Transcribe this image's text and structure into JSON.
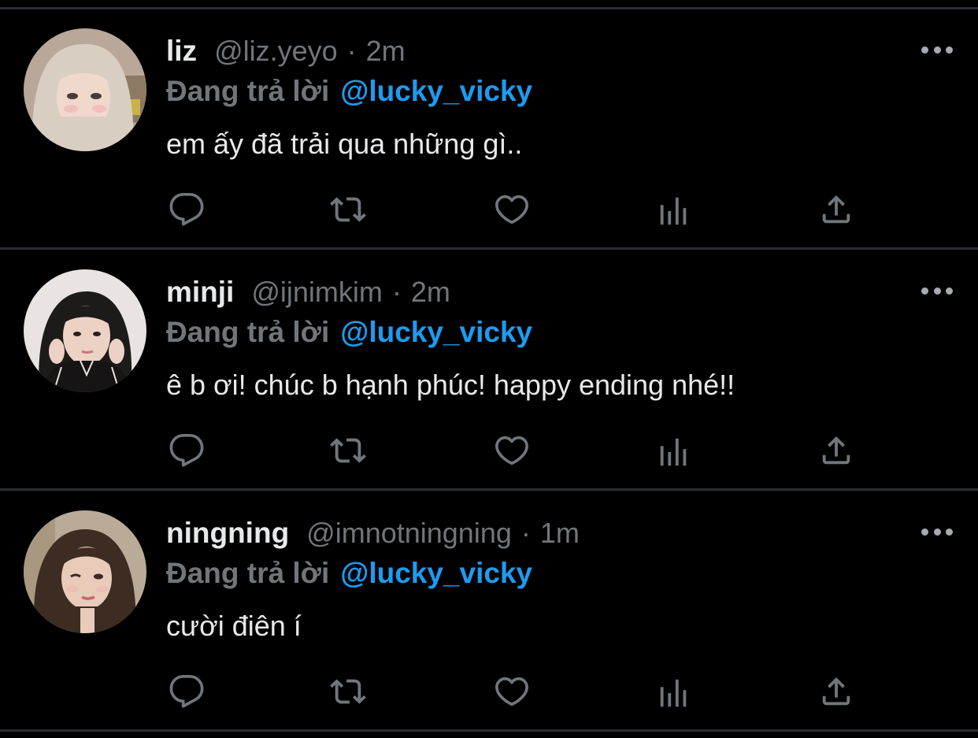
{
  "tweets": [
    {
      "name": "liz",
      "handle": "@liz.yeyo",
      "separator": "·",
      "time": "2m",
      "replying_prefix": "Đang trả lời",
      "replying_to": "@lucky_vicky",
      "text": "em ấy đã trải qua những gì..",
      "avatar_colors": {
        "bg": "#b9a89a",
        "hair": "#d8cfc2",
        "skin": "#f1d8cc"
      }
    },
    {
      "name": "minji",
      "handle": "@ijnimkim",
      "separator": "·",
      "time": "2m",
      "replying_prefix": "Đang trả lời",
      "replying_to": "@lucky_vicky",
      "text": "ê b ơi! chúc b hạnh phúc! happy ending nhé!!",
      "avatar_colors": {
        "bg": "#e9e4e2",
        "hair": "#1d1a1a",
        "skin": "#ecd2c4"
      }
    },
    {
      "name": "ningning",
      "handle": "@imnotningning",
      "separator": "·",
      "time": "1m",
      "replying_prefix": "Đang trả lời",
      "replying_to": "@lucky_vicky",
      "text": "cười điên í",
      "avatar_colors": {
        "bg": "#b9ab98",
        "hair": "#3d2c22",
        "skin": "#e9cbb9"
      }
    }
  ],
  "icons": [
    "reply-icon",
    "retweet-icon",
    "like-icon",
    "analytics-icon",
    "share-icon",
    "more-icon"
  ],
  "colors": {
    "background": "#000000",
    "primary_text": "#e7e9ea",
    "secondary_text": "#71767b",
    "link": "#1d9bf0",
    "icon": "#71767b",
    "divider": "#2a2d31"
  }
}
